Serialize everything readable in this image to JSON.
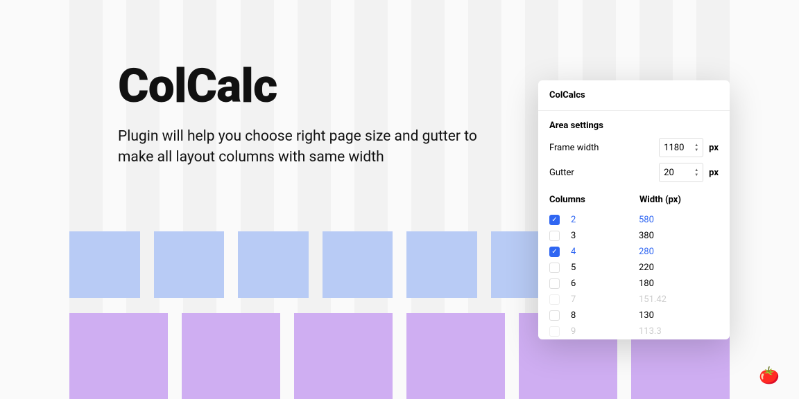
{
  "hero": {
    "title": "ColCalc",
    "description": "Plugin will help you choose right page size and gutter to make all layout columns with same width"
  },
  "panel": {
    "title": "ColCalcs",
    "area_settings": {
      "heading": "Area settings",
      "frame_width": {
        "label": "Frame width",
        "value": "1180",
        "unit": "px"
      },
      "gutter": {
        "label": "Gutter",
        "value": "20",
        "unit": "px"
      }
    },
    "columns": {
      "heading_cols": "Columns",
      "heading_width": "Width (px)",
      "rows": [
        {
          "cols": "2",
          "width": "580",
          "selected": true,
          "fade": false
        },
        {
          "cols": "3",
          "width": "380",
          "selected": false,
          "fade": false
        },
        {
          "cols": "4",
          "width": "280",
          "selected": true,
          "fade": false
        },
        {
          "cols": "5",
          "width": "220",
          "selected": false,
          "fade": false
        },
        {
          "cols": "6",
          "width": "180",
          "selected": false,
          "fade": false
        },
        {
          "cols": "7",
          "width": "151.42",
          "selected": false,
          "fade": true
        },
        {
          "cols": "8",
          "width": "130",
          "selected": false,
          "fade": false
        },
        {
          "cols": "9",
          "width": "113.3",
          "selected": false,
          "fade": true
        }
      ]
    }
  },
  "demo": {
    "blue_cols": 8,
    "purple_cols": 6
  },
  "bg_cols": 12,
  "emoji": "🍅"
}
